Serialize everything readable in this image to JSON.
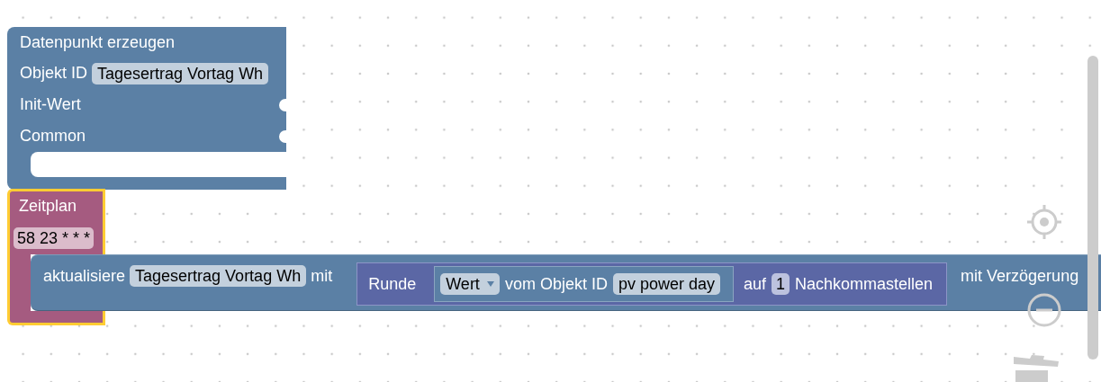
{
  "create_block": {
    "title": "Datenpunkt erzeugen",
    "rows": [
      {
        "label": "Objekt ID",
        "field": "Tagesertrag Vortag Wh"
      },
      {
        "label": "Init-Wert"
      },
      {
        "label": "Common"
      }
    ]
  },
  "schedule_block": {
    "title": "Zeitplan",
    "cron": "58 23 * * *",
    "selected": true,
    "statement": {
      "label": "aktualisiere",
      "field": "Tagesertrag Vortag Wh",
      "with": "mit",
      "value": {
        "label": "Runde",
        "inner": {
          "dropdown": "Wert",
          "text": "vom Objekt ID",
          "field": "pv power day"
        },
        "to": "auf",
        "digits": "1",
        "suffix": "Nachkommastellen"
      },
      "delay_label": "mit Verzögerung"
    }
  }
}
